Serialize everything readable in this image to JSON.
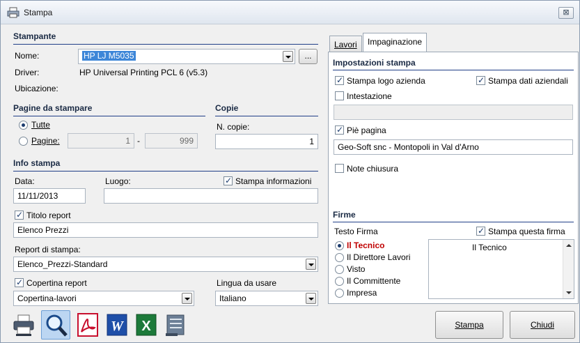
{
  "window": {
    "title": "Stampa",
    "close_label": "⊠"
  },
  "stampante": {
    "section": "Stampante",
    "nome_label": "Nome:",
    "nome_value": "HP LJ M5035",
    "browse_label": "...",
    "driver_label": "Driver:",
    "driver_value": "HP Universal Printing PCL 6 (v5.3)",
    "ubicazione_label": "Ubicazione:"
  },
  "pagine": {
    "section": "Pagine da stampare",
    "tutte_label": "Tutte",
    "tutte_selected": true,
    "pagine_label": "Pagine:",
    "from": "1",
    "dash": "-",
    "to": "999"
  },
  "copie": {
    "section": "Copie",
    "label": "N. copie:",
    "value": "1"
  },
  "info": {
    "section": "Info stampa",
    "data_label": "Data:",
    "data_value": "11/11/2013",
    "luogo_label": "Luogo:",
    "luogo_value": "",
    "stampa_info_label": "Stampa informazioni",
    "stampa_info_checked": true,
    "titolo_label": "Titolo report",
    "titolo_checked": true,
    "titolo_value": "Elenco Prezzi",
    "report_label": "Report di stampa:",
    "report_value": "Elenco_Prezzi-Standard",
    "copertina_label": "Copertina report",
    "copertina_checked": true,
    "copertina_value": "Copertina-lavori",
    "lingua_label": "Lingua da usare",
    "lingua_value": "Italiano"
  },
  "tabs": [
    {
      "label": "Lavori",
      "active": false
    },
    {
      "label": "Impaginazione",
      "active": true
    }
  ],
  "impostazioni": {
    "section": "Impostazioni stampa",
    "logo_label": "Stampa logo azienda",
    "logo_checked": true,
    "dati_label": "Stampa dati aziendali",
    "dati_checked": true,
    "intestazione_label": "Intestazione",
    "intestazione_checked": false,
    "intestazione_value": "",
    "pie_label": "Piè pagina",
    "pie_checked": true,
    "pie_value": "Geo-Soft snc - Montopoli in Val d'Arno",
    "note_label": "Note chiusura",
    "note_checked": false
  },
  "firme": {
    "section": "Firme",
    "testo_label": "Testo Firma",
    "stampa_firma_label": "Stampa questa firma",
    "stampa_firma_checked": true,
    "options": [
      "Il Tecnico",
      "Il Direttore Lavori",
      "Visto",
      "Il Committente",
      "Impresa"
    ],
    "selected_index": 0,
    "testo_value": "Il Tecnico",
    "selected_color": "#c00000"
  },
  "toolbar": {
    "icons": [
      "printer-icon",
      "preview-icon",
      "pdf-icon",
      "word-icon",
      "excel-icon",
      "export-icon"
    ]
  },
  "buttons": {
    "stampa": "Stampa",
    "chiudi": "Chiudi"
  }
}
